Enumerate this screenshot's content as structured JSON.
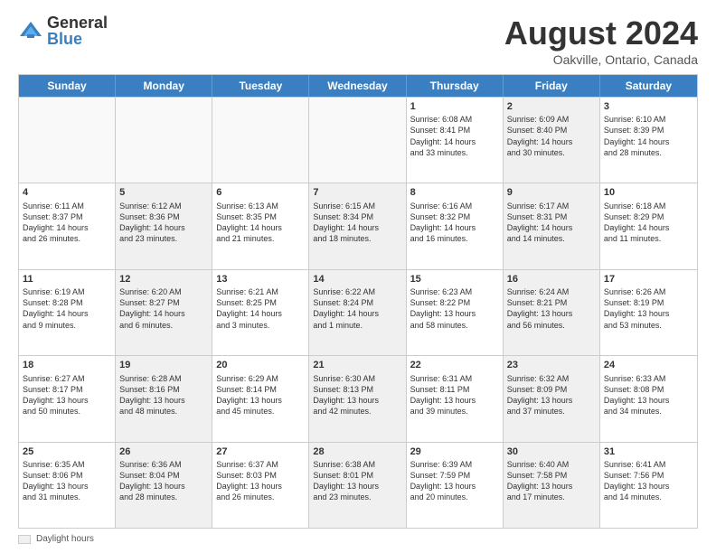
{
  "logo": {
    "general": "General",
    "blue": "Blue"
  },
  "title": {
    "month_year": "August 2024",
    "location": "Oakville, Ontario, Canada"
  },
  "days_of_week": [
    "Sunday",
    "Monday",
    "Tuesday",
    "Wednesday",
    "Thursday",
    "Friday",
    "Saturday"
  ],
  "legend": {
    "label": "Daylight hours"
  },
  "weeks": [
    {
      "cells": [
        {
          "day": "",
          "empty": true
        },
        {
          "day": "",
          "empty": true
        },
        {
          "day": "",
          "empty": true
        },
        {
          "day": "",
          "empty": true
        },
        {
          "day": "1",
          "info": "Sunrise: 6:08 AM\nSunset: 8:41 PM\nDaylight: 14 hours\nand 33 minutes."
        },
        {
          "day": "2",
          "info": "Sunrise: 6:09 AM\nSunset: 8:40 PM\nDaylight: 14 hours\nand 30 minutes.",
          "shaded": true
        },
        {
          "day": "3",
          "info": "Sunrise: 6:10 AM\nSunset: 8:39 PM\nDaylight: 14 hours\nand 28 minutes."
        }
      ]
    },
    {
      "cells": [
        {
          "day": "4",
          "info": "Sunrise: 6:11 AM\nSunset: 8:37 PM\nDaylight: 14 hours\nand 26 minutes."
        },
        {
          "day": "5",
          "info": "Sunrise: 6:12 AM\nSunset: 8:36 PM\nDaylight: 14 hours\nand 23 minutes.",
          "shaded": true
        },
        {
          "day": "6",
          "info": "Sunrise: 6:13 AM\nSunset: 8:35 PM\nDaylight: 14 hours\nand 21 minutes."
        },
        {
          "day": "7",
          "info": "Sunrise: 6:15 AM\nSunset: 8:34 PM\nDaylight: 14 hours\nand 18 minutes.",
          "shaded": true
        },
        {
          "day": "8",
          "info": "Sunrise: 6:16 AM\nSunset: 8:32 PM\nDaylight: 14 hours\nand 16 minutes."
        },
        {
          "day": "9",
          "info": "Sunrise: 6:17 AM\nSunset: 8:31 PM\nDaylight: 14 hours\nand 14 minutes.",
          "shaded": true
        },
        {
          "day": "10",
          "info": "Sunrise: 6:18 AM\nSunset: 8:29 PM\nDaylight: 14 hours\nand 11 minutes."
        }
      ]
    },
    {
      "cells": [
        {
          "day": "11",
          "info": "Sunrise: 6:19 AM\nSunset: 8:28 PM\nDaylight: 14 hours\nand 9 minutes."
        },
        {
          "day": "12",
          "info": "Sunrise: 6:20 AM\nSunset: 8:27 PM\nDaylight: 14 hours\nand 6 minutes.",
          "shaded": true
        },
        {
          "day": "13",
          "info": "Sunrise: 6:21 AM\nSunset: 8:25 PM\nDaylight: 14 hours\nand 3 minutes."
        },
        {
          "day": "14",
          "info": "Sunrise: 6:22 AM\nSunset: 8:24 PM\nDaylight: 14 hours\nand 1 minute.",
          "shaded": true
        },
        {
          "day": "15",
          "info": "Sunrise: 6:23 AM\nSunset: 8:22 PM\nDaylight: 13 hours\nand 58 minutes."
        },
        {
          "day": "16",
          "info": "Sunrise: 6:24 AM\nSunset: 8:21 PM\nDaylight: 13 hours\nand 56 minutes.",
          "shaded": true
        },
        {
          "day": "17",
          "info": "Sunrise: 6:26 AM\nSunset: 8:19 PM\nDaylight: 13 hours\nand 53 minutes."
        }
      ]
    },
    {
      "cells": [
        {
          "day": "18",
          "info": "Sunrise: 6:27 AM\nSunset: 8:17 PM\nDaylight: 13 hours\nand 50 minutes."
        },
        {
          "day": "19",
          "info": "Sunrise: 6:28 AM\nSunset: 8:16 PM\nDaylight: 13 hours\nand 48 minutes.",
          "shaded": true
        },
        {
          "day": "20",
          "info": "Sunrise: 6:29 AM\nSunset: 8:14 PM\nDaylight: 13 hours\nand 45 minutes."
        },
        {
          "day": "21",
          "info": "Sunrise: 6:30 AM\nSunset: 8:13 PM\nDaylight: 13 hours\nand 42 minutes.",
          "shaded": true
        },
        {
          "day": "22",
          "info": "Sunrise: 6:31 AM\nSunset: 8:11 PM\nDaylight: 13 hours\nand 39 minutes."
        },
        {
          "day": "23",
          "info": "Sunrise: 6:32 AM\nSunset: 8:09 PM\nDaylight: 13 hours\nand 37 minutes.",
          "shaded": true
        },
        {
          "day": "24",
          "info": "Sunrise: 6:33 AM\nSunset: 8:08 PM\nDaylight: 13 hours\nand 34 minutes."
        }
      ]
    },
    {
      "cells": [
        {
          "day": "25",
          "info": "Sunrise: 6:35 AM\nSunset: 8:06 PM\nDaylight: 13 hours\nand 31 minutes."
        },
        {
          "day": "26",
          "info": "Sunrise: 6:36 AM\nSunset: 8:04 PM\nDaylight: 13 hours\nand 28 minutes.",
          "shaded": true
        },
        {
          "day": "27",
          "info": "Sunrise: 6:37 AM\nSunset: 8:03 PM\nDaylight: 13 hours\nand 26 minutes."
        },
        {
          "day": "28",
          "info": "Sunrise: 6:38 AM\nSunset: 8:01 PM\nDaylight: 13 hours\nand 23 minutes.",
          "shaded": true
        },
        {
          "day": "29",
          "info": "Sunrise: 6:39 AM\nSunset: 7:59 PM\nDaylight: 13 hours\nand 20 minutes."
        },
        {
          "day": "30",
          "info": "Sunrise: 6:40 AM\nSunset: 7:58 PM\nDaylight: 13 hours\nand 17 minutes.",
          "shaded": true
        },
        {
          "day": "31",
          "info": "Sunrise: 6:41 AM\nSunset: 7:56 PM\nDaylight: 13 hours\nand 14 minutes."
        }
      ]
    }
  ]
}
